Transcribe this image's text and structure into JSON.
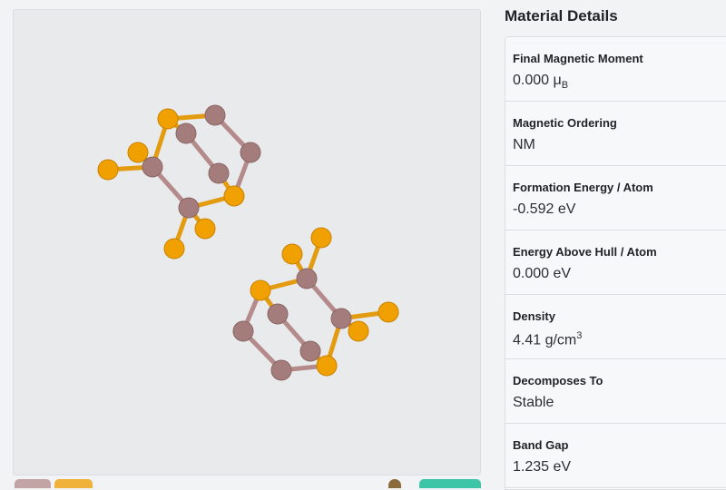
{
  "viewer": {
    "colors": {
      "bond_mo": "#b48a8a",
      "bond_s": "#e39b10",
      "atom_mo": "#a47c7c",
      "atom_s": "#f0a000"
    }
  },
  "details": {
    "title": "Material Details",
    "items": [
      {
        "label": "Final Magnetic Moment",
        "value": "0.000 μ",
        "sub": "B"
      },
      {
        "label": "Magnetic Ordering",
        "value": "NM"
      },
      {
        "label": "Formation Energy / Atom",
        "value": "-0.592 eV"
      },
      {
        "label": "Energy Above Hull / Atom",
        "value": "0.000 eV"
      },
      {
        "label": "Density",
        "value": "4.41 g/cm",
        "sup": "3"
      },
      {
        "label": "Decomposes To",
        "value": "Stable"
      },
      {
        "label": "Band Gap",
        "value": "1.235 eV"
      }
    ]
  }
}
